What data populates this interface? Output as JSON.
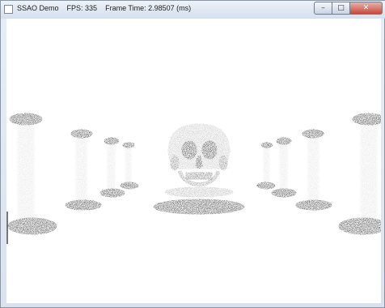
{
  "window": {
    "title": "SSAO Demo",
    "fps_text": "FPS: 335",
    "frame_time_text": "Frame Time: 2.98507 (ms)",
    "minimize_glyph": "–",
    "maximize_glyph": "□",
    "close_glyph": "✕"
  },
  "scene": {
    "background_color": "#ffffff",
    "ink_color": "#1c1c1c"
  }
}
